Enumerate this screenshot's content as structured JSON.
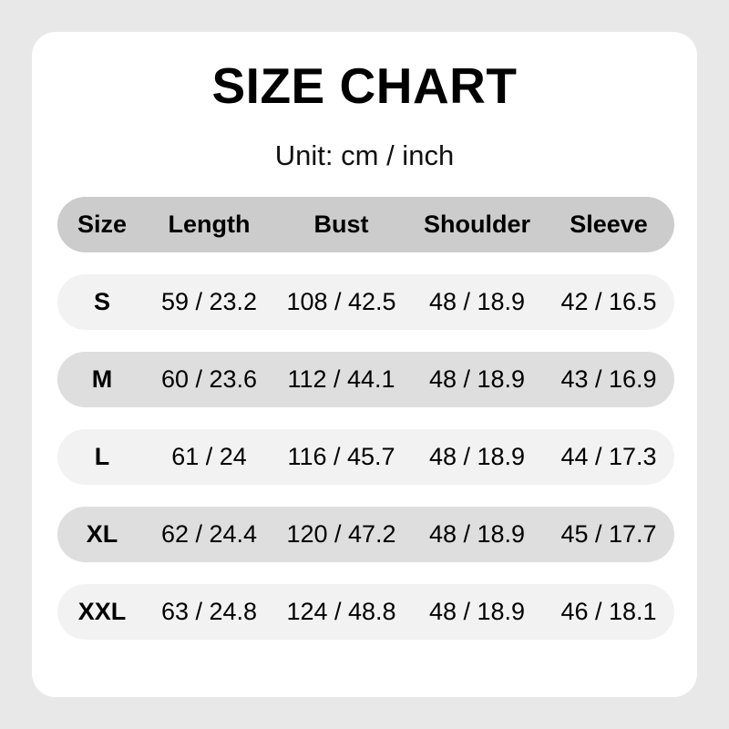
{
  "card": {
    "title": "SIZE CHART",
    "unit": "Unit: cm / inch"
  },
  "colors": {
    "page_background": "#e8e8e8",
    "card_background": "#ffffff",
    "header_row": "#cccccc",
    "row_light": "#f2f2f2",
    "row_dark": "#dedede",
    "text": "#000000"
  },
  "table": {
    "columns": [
      "Size",
      "Length",
      "Bust",
      "Shoulder",
      "Sleeve"
    ],
    "rows": [
      {
        "size": "S",
        "length": "59 / 23.2",
        "bust": "108 / 42.5",
        "shoulder": "48 / 18.9",
        "sleeve": "42 / 16.5"
      },
      {
        "size": "M",
        "length": "60 / 23.6",
        "bust": "112 / 44.1",
        "shoulder": "48 / 18.9",
        "sleeve": "43 / 16.9"
      },
      {
        "size": "L",
        "length": "61 / 24",
        "bust": "116 / 45.7",
        "shoulder": "48 / 18.9",
        "sleeve": "44 / 17.3"
      },
      {
        "size": "XL",
        "length": "62 / 24.4",
        "bust": "120 / 47.2",
        "shoulder": "48 / 18.9",
        "sleeve": "45 / 17.7"
      },
      {
        "size": "XXL",
        "length": "63 / 24.8",
        "bust": "124 / 48.8",
        "shoulder": "48 / 18.9",
        "sleeve": "46 / 18.1"
      }
    ]
  }
}
